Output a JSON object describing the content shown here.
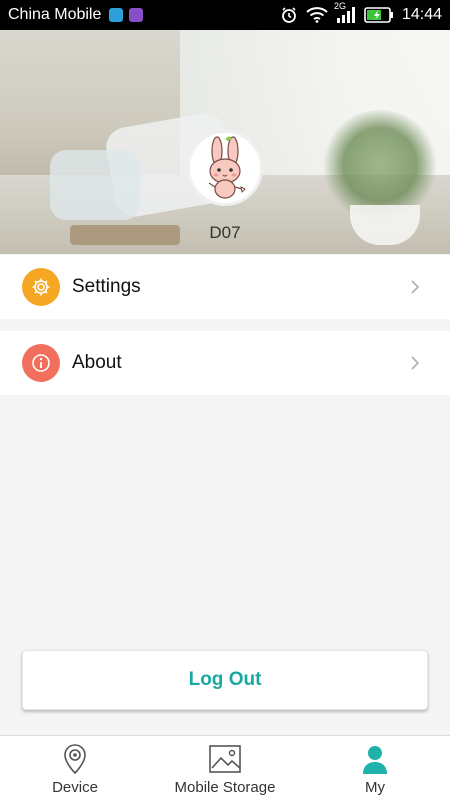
{
  "status_bar": {
    "carrier": "China Mobile",
    "network": "2G",
    "time": "14:44"
  },
  "profile": {
    "device_name": "D07",
    "avatar_icon": "bunny-avatar-icon"
  },
  "menu": [
    {
      "label": "Settings",
      "icon": "gear-icon",
      "icon_color": "#f5a623"
    },
    {
      "label": "About",
      "icon": "info-icon",
      "icon_color": "#f26f5e"
    }
  ],
  "logout_label": "Log Out",
  "tabs": [
    {
      "label": "Device",
      "icon": "camera-pin-icon",
      "active": false
    },
    {
      "label": "Mobile Storage",
      "icon": "image-icon",
      "active": false
    },
    {
      "label": "My",
      "icon": "person-icon",
      "active": true
    }
  ],
  "colors": {
    "accent": "#1aa8a0",
    "active_tab_icon": "#20b2aa"
  }
}
